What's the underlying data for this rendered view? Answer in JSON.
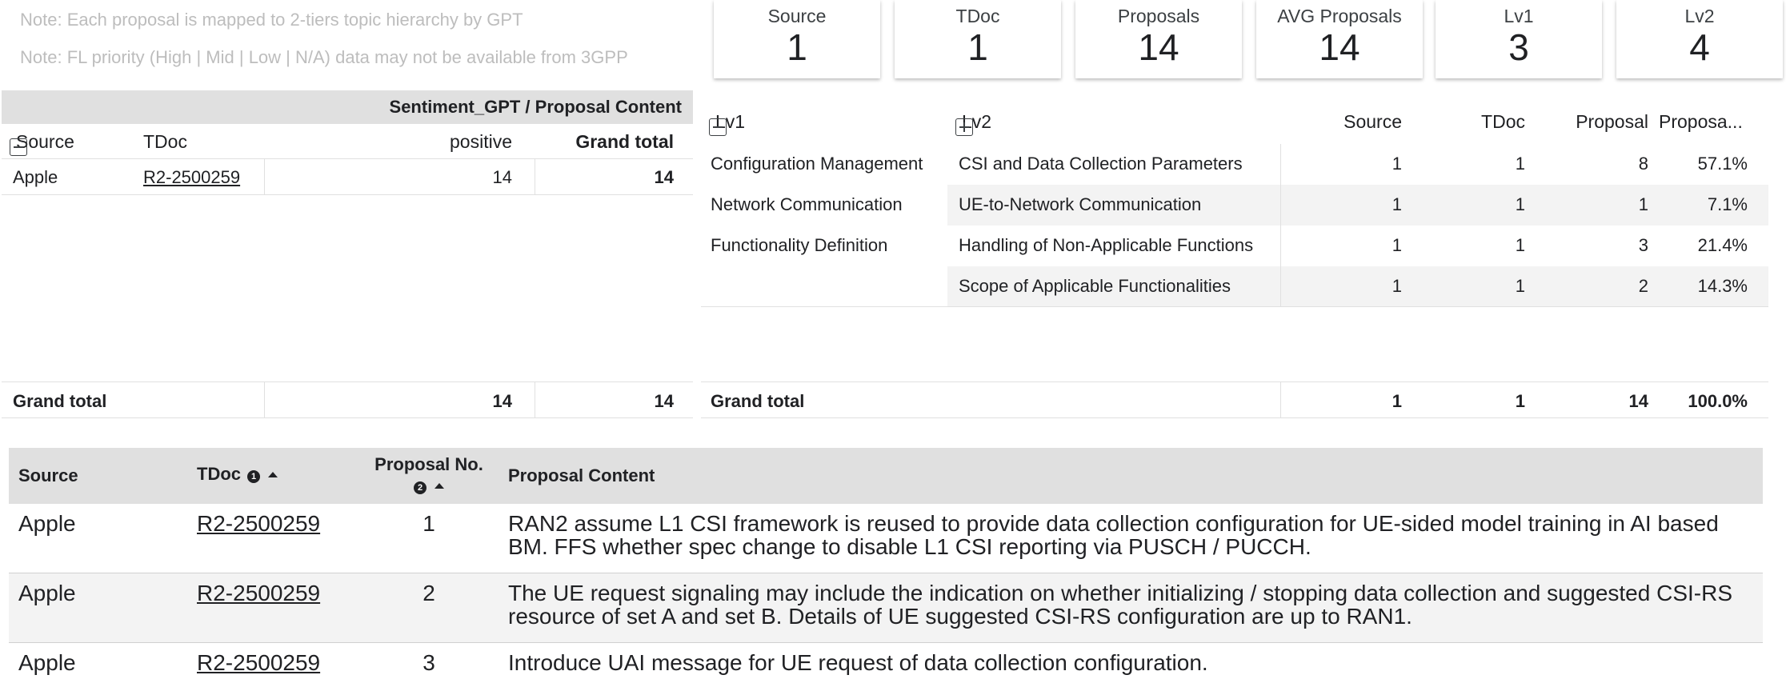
{
  "notes": [
    "Note: Each proposal is mapped to 2-tiers topic hierarchy by GPT",
    "Note: FL priority (High | Mid | Low | N/A) data may not be available from 3GPP"
  ],
  "kpis": [
    {
      "label": "Source",
      "value": "1"
    },
    {
      "label": "TDoc",
      "value": "1"
    },
    {
      "label": "Proposals",
      "value": "14"
    },
    {
      "label": "AVG Proposals",
      "value": "14"
    },
    {
      "label": "Lv1",
      "value": "3"
    },
    {
      "label": "Lv2",
      "value": "4"
    }
  ],
  "left_pivot": {
    "column_group": "Sentiment_GPT / Proposal Content",
    "headers": {
      "source": "Source",
      "tdoc": "TDoc",
      "positive": "positive",
      "grand_total": "Grand total"
    },
    "rows": [
      {
        "source": "Apple",
        "tdoc": "R2-2500259",
        "positive": "14",
        "grand_total": "14"
      }
    ],
    "total": {
      "label": "Grand total",
      "positive": "14",
      "grand_total": "14"
    }
  },
  "right_pivot": {
    "headers": {
      "lv1": "Lv1",
      "lv2": "Lv2",
      "source": "Source",
      "tdoc": "TDoc",
      "proposal": "Proposal",
      "proposal_pct": "Proposa..."
    },
    "rows": [
      {
        "lv1": "Configuration Management",
        "lv2": "CSI and Data Collection Parameters",
        "source": "1",
        "tdoc": "1",
        "proposal": "8",
        "pct": "57.1%"
      },
      {
        "lv1": "Network Communication",
        "lv2": "UE-to-Network Communication",
        "source": "1",
        "tdoc": "1",
        "proposal": "1",
        "pct": "7.1%"
      },
      {
        "lv1": "Functionality Definition",
        "lv2": "Handling of Non-Applicable Functions",
        "source": "1",
        "tdoc": "1",
        "proposal": "3",
        "pct": "21.4%"
      },
      {
        "lv1": "",
        "lv2": "Scope of Applicable Functionalities",
        "source": "1",
        "tdoc": "1",
        "proposal": "2",
        "pct": "14.3%"
      }
    ],
    "total": {
      "label": "Grand total",
      "source": "1",
      "tdoc": "1",
      "proposal": "14",
      "pct": "100.0%"
    }
  },
  "detail_table": {
    "headers": {
      "source": "Source",
      "tdoc": "TDoc",
      "tdoc_sort": "1",
      "proposal_no_line1": "Proposal No.",
      "proposal_sort": "2",
      "content": "Proposal Content"
    },
    "rows": [
      {
        "source": "Apple",
        "tdoc": "R2-2500259",
        "no": "1",
        "content": "RAN2 assume L1 CSI framework is reused to provide data collection configuration for UE-sided model training in AI based BM. FFS whether spec change to disable L1 CSI reporting via PUSCH / PUCCH."
      },
      {
        "source": "Apple",
        "tdoc": "R2-2500259",
        "no": "2",
        "content": "The UE request signaling may include the indication on whether initializing / stopping data collection and suggested CSI-RS resource of set A and set B. Details of UE suggested CSI-RS configuration are up to RAN1."
      },
      {
        "source": "Apple",
        "tdoc": "R2-2500259",
        "no": "3",
        "content": "Introduce UAI message for UE request of data collection configuration."
      }
    ]
  },
  "colors": {
    "header_bg": "#e0e0e0",
    "zebra": "#f3f3f3",
    "text": "#202124",
    "note": "#bdbdbd"
  }
}
